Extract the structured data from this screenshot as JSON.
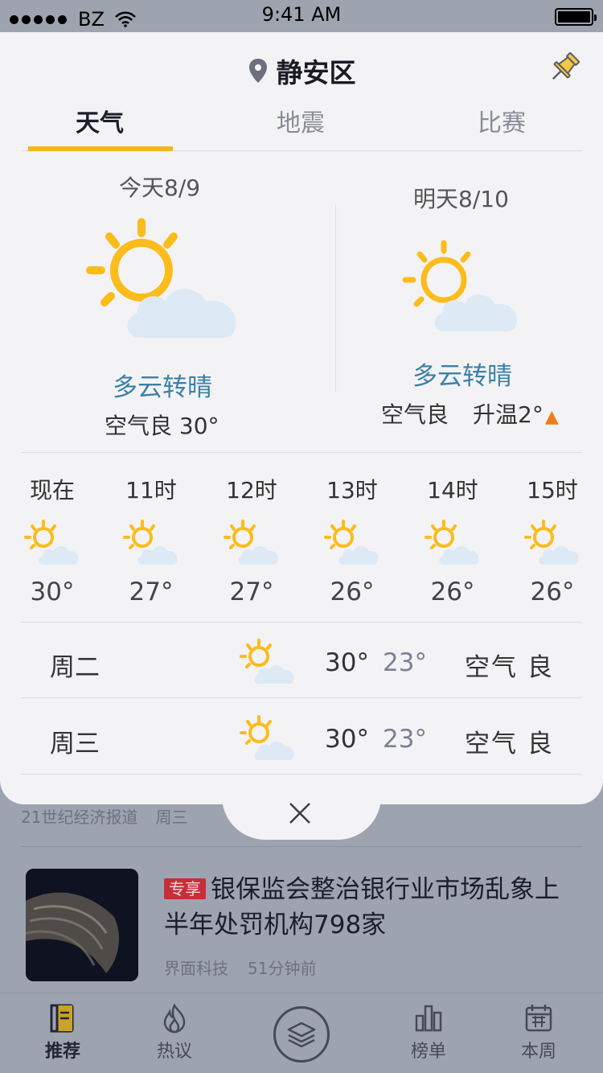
{
  "status_bar": {
    "carrier": "BZ",
    "time": "9:41 AM"
  },
  "location": {
    "name": "静安区"
  },
  "tabs": [
    {
      "label": "天气",
      "active": true
    },
    {
      "label": "地震",
      "active": false
    },
    {
      "label": "比赛",
      "active": false
    }
  ],
  "today": {
    "label": "今天8/9",
    "condition": "多云转晴",
    "air": "空气良 30°",
    "icon": "partly-cloudy-sunny-icon"
  },
  "tomorrow": {
    "label": "明天8/10",
    "condition": "多云转晴",
    "air": "空气良",
    "trend": "升温2°",
    "trend_icon": "arrow-up-icon"
  },
  "hourly": [
    {
      "time": "现在",
      "temp": "30°"
    },
    {
      "time": "11时",
      "temp": "27°"
    },
    {
      "time": "12时",
      "temp": "27°"
    },
    {
      "time": "13时",
      "temp": "26°"
    },
    {
      "time": "14时",
      "temp": "26°"
    },
    {
      "time": "15时",
      "temp": "26°"
    }
  ],
  "daily": [
    {
      "day": "周二",
      "high": "30°",
      "low": "23°",
      "air": "空气 良"
    },
    {
      "day": "周三",
      "high": "30°",
      "low": "23°",
      "air": "空气 良"
    }
  ],
  "feed": {
    "prev_meta": {
      "source": "21世纪经济报道",
      "time": "周三"
    },
    "card": {
      "tag": "专享",
      "title": "银保监会整治银行业市场乱象上半年处罚机构798家",
      "source": "界面科技",
      "time": "51分钟前"
    }
  },
  "bottom_tabs": [
    {
      "label": "推荐",
      "icon": "book-icon",
      "active": true
    },
    {
      "label": "热议",
      "icon": "flame-icon",
      "active": false
    },
    {
      "label": "",
      "icon": "layers-icon",
      "active": false
    },
    {
      "label": "榜单",
      "icon": "bar-chart-icon",
      "active": false
    },
    {
      "label": "本周",
      "icon": "calendar-icon",
      "active": false
    }
  ],
  "colors": {
    "accent": "#f7b41c",
    "condition": "#3b80a8",
    "sun": "#fbbc1c",
    "cloud": "#ddeaf6",
    "tag": "#c62f3a"
  }
}
